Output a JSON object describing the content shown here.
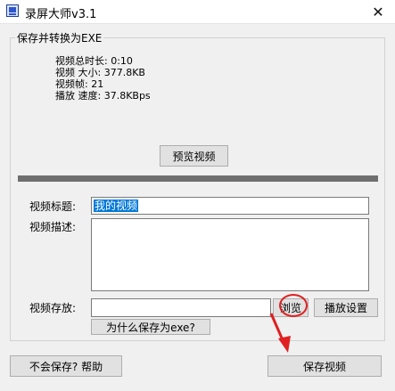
{
  "window": {
    "title": "录屏大师v3.1",
    "close_label": "✕"
  },
  "group": {
    "title": "保存并转换为EXE"
  },
  "video_info": {
    "duration": "视频总时长: 0:10",
    "size": "视频 大小: 377.8KB",
    "frames": "视频帧: 21",
    "speed": "播放 速度: 37.8KBps"
  },
  "preview_button": "预览视频",
  "form": {
    "title_label": "视频标题:",
    "title_value": "我的视频",
    "desc_label": "视频描述:",
    "desc_value": "",
    "path_label": "视频存放:",
    "path_value": "",
    "browse_button": "浏览",
    "playback_settings_button": "播放设置",
    "why_exe_button": "为什么保存为exe?"
  },
  "footer": {
    "help_button": "不会保存? 帮助",
    "save_button": "保存视频"
  },
  "annotation_color": "#e02020"
}
